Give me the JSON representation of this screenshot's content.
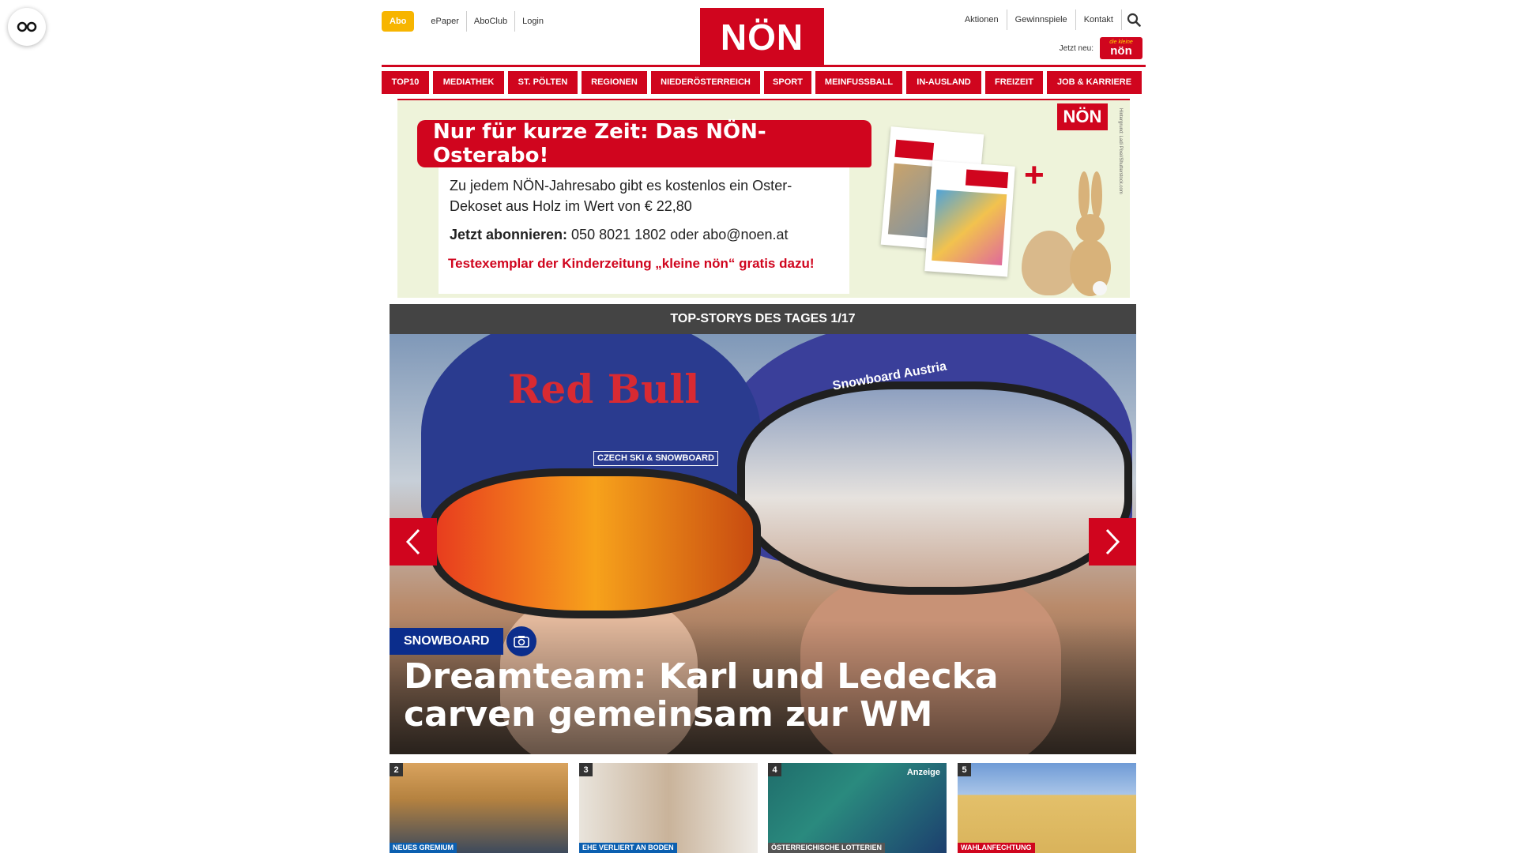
{
  "header": {
    "abo_label": "Abo",
    "left_links": [
      "ePaper",
      "AboClub",
      "Login"
    ],
    "logo_text": "NÖN",
    "right_links": [
      "Aktionen",
      "Gewinnspiele",
      "Kontakt"
    ],
    "jetzt_neu_label": "Jetzt neu:",
    "kleine_logo_top": "die kleine",
    "kleine_logo_bottom": "nön",
    "brand_color": "#d0051e"
  },
  "nav": {
    "items": [
      "TOP10",
      "MEDIATHEK",
      "ST. PÖLTEN",
      "REGIONEN",
      "NIEDERÖSTERREICH",
      "SPORT",
      "MEINFUSSBALL",
      "IN-AUSLAND",
      "FREIZEIT",
      "JOB & KARRIERE"
    ]
  },
  "banner": {
    "headline": "Nur für kurze Zeit: Das NÖN-Osterabo!",
    "body": "Zu jedem NÖN-Jahresabo gibt es kostenlos ein Oster-Dekoset aus Holz im Wert von € 22,80",
    "phone_label": "Jetzt abonnieren:",
    "phone_value": "050 8021 1802 oder abo@noen.at",
    "cta": "Testexemplar der Kinderzeitung „kleine nön“ gratis dazu!",
    "logo": "NÖN",
    "credit": "Hintergrund: Ladi Pixel/Shutterstock.com"
  },
  "top_stories": {
    "bar_label": "TOP-STORYS DES TAGES 1/17",
    "hero": {
      "category": "SNOWBOARD",
      "title": "Dreamteam: Karl und Ledecka carven gemeinsam zur WM",
      "image_texts": {
        "helmet_brand": "Red Bull",
        "sticker": "CZECH SKI & SNOWBOARD",
        "helmet_right": "Snowboard Austria"
      }
    },
    "thumbs": [
      {
        "num": "2",
        "tag": "NEUES GREMIUM",
        "tag_color": "#0b5fb0",
        "ad": ""
      },
      {
        "num": "3",
        "tag": "EHE VERLIERT AN BODEN",
        "tag_color": "#0b5fb0",
        "ad": ""
      },
      {
        "num": "4",
        "tag": "ÖSTERREICHISCHE LOTTERIEN",
        "tag_color": "#555555",
        "ad": "Anzeige"
      },
      {
        "num": "5",
        "tag": "WAHLANFECHTUNG",
        "tag_color": "#d0051e",
        "ad": ""
      }
    ]
  }
}
